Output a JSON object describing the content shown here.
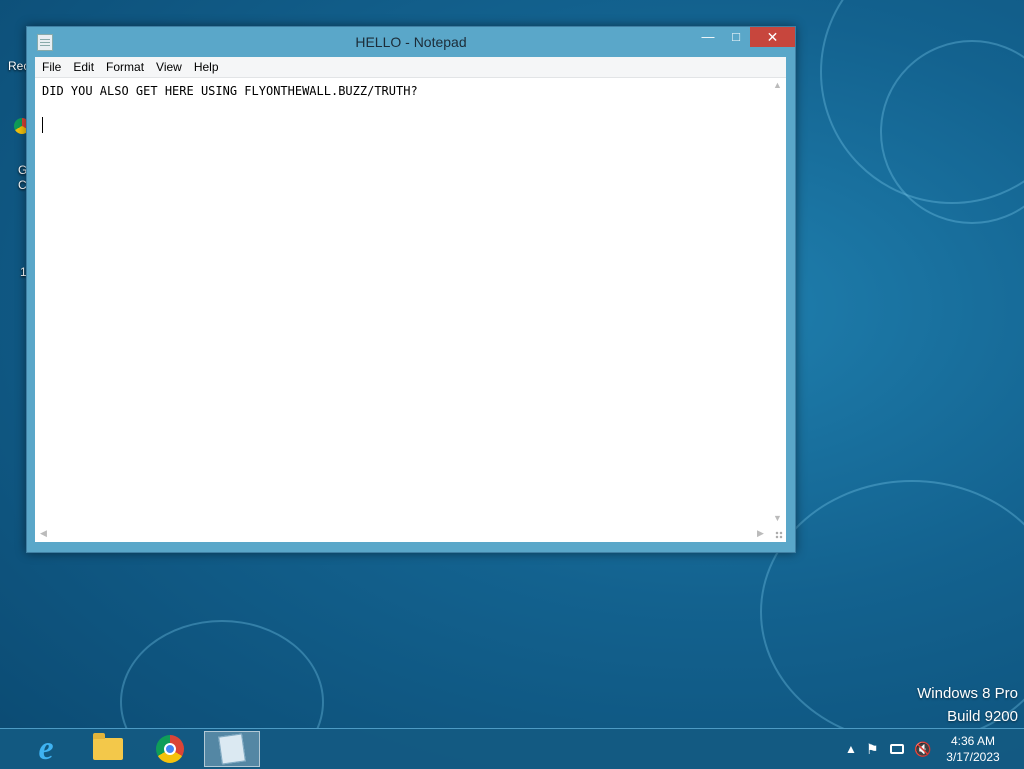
{
  "desktop": {
    "recycle_label": "Rec",
    "chrome_label_1": "G",
    "chrome_label_2": "C",
    "other_label": "1",
    "watermark_line1": "Windows 8 Pro",
    "watermark_line2": "Build 9200"
  },
  "window": {
    "title": "HELLO - Notepad",
    "minimize_glyph": "—",
    "maximize_glyph": "□",
    "close_glyph": "✕",
    "menu": [
      {
        "label": "File"
      },
      {
        "label": "Edit"
      },
      {
        "label": "Format"
      },
      {
        "label": "View"
      },
      {
        "label": "Help"
      }
    ],
    "content": "DID YOU ALSO GET HERE USING FLYONTHEWALL.BUZZ/TRUTH?"
  },
  "taskbar": {
    "apps": [
      {
        "name": "Internet Explorer",
        "icon": "ie-icon"
      },
      {
        "name": "File Explorer",
        "icon": "folder-icon"
      },
      {
        "name": "Google Chrome",
        "icon": "chrome-icon"
      },
      {
        "name": "Notepad",
        "icon": "notepad-icon",
        "active": true
      }
    ],
    "clock_time": "4:36 AM",
    "clock_date": "3/17/2023",
    "tray_icons": [
      "show-hidden-icons",
      "flag-icon",
      "network-icon",
      "volume-muted-icon"
    ]
  },
  "colors": {
    "titlebar": "#5aa7c9",
    "close_button": "#c7463d",
    "taskbar": "#145a82"
  }
}
